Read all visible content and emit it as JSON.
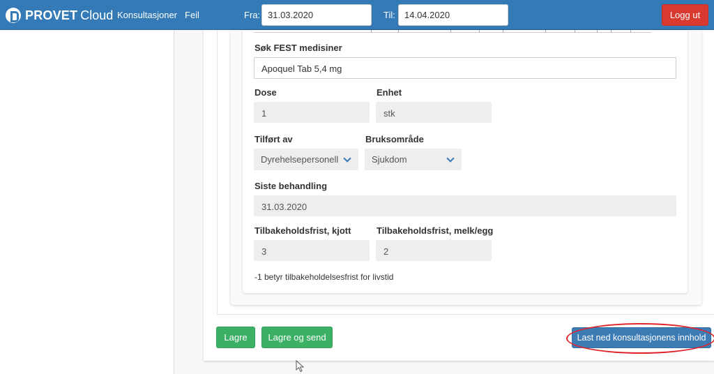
{
  "brand": {
    "name_bold": "PROVET",
    "name_light": "Cloud"
  },
  "nav": {
    "consultations": "Konsultasjoner",
    "errors": "Feil"
  },
  "date_filter": {
    "from_label": "Fra:",
    "from_value": "31.03.2020",
    "to_label": "Til:",
    "to_value": "14.04.2020"
  },
  "logout_label": "Logg ut",
  "form": {
    "search_label": "Søk FEST medisiner",
    "search_value": "Apoquel Tab 5,4 mg",
    "dose_label": "Dose",
    "dose_value": "1",
    "unit_label": "Enhet",
    "unit_value": "stk",
    "administered_by_label": "Tilført av",
    "administered_by_value": "Dyrehelsepersonell",
    "usage_area_label": "Bruksområde",
    "usage_area_value": "Sjukdom",
    "last_treatment_label": "Siste behandling",
    "last_treatment_value": "31.03.2020",
    "withdrawal_meat_label": "Tilbakeholdsfrist, kjott",
    "withdrawal_meat_value": "3",
    "withdrawal_milk_label": "Tilbakeholdsfrist, melk/egg",
    "withdrawal_milk_value": "2",
    "note": "-1 betyr tilbakeholdelsesfrist for livstid"
  },
  "actions": {
    "save": "Lagre",
    "save_send": "Lagre og send",
    "download": "Last ned konsultasjonens innhold"
  },
  "colors": {
    "navbar": "#337ab7",
    "logout": "#d9392f",
    "green": "#3cb065",
    "download": "#3d7bb5",
    "annotation": "#e0242a"
  }
}
